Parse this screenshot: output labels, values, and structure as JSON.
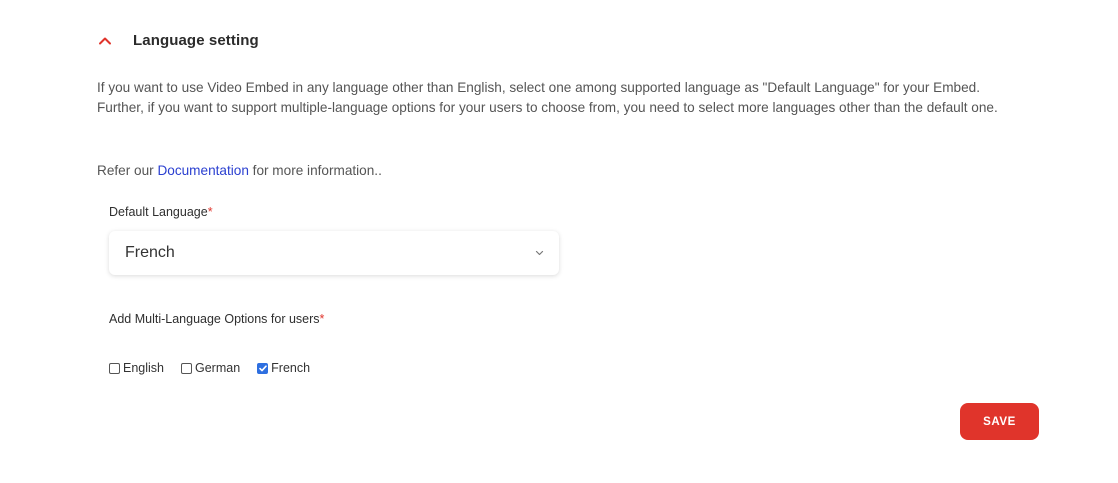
{
  "section": {
    "title": "Language setting",
    "expanded": true,
    "toggle_icon": "chevron-up-icon",
    "accent_color": "#e0342b"
  },
  "description": "If you want to use Video Embed in any language other than English, select one among supported language as \"Default Language\" for your Embed. Further, if you want to support multiple-language options for your users to choose from, you need to select more languages other than the default one.",
  "refer": {
    "prefix": "Refer our ",
    "link_text": "Documentation",
    "suffix": " for more information.."
  },
  "default_language": {
    "label": "Default Language",
    "required_mark": "*",
    "selected": "French",
    "caret_icon": "chevron-down-icon"
  },
  "multi_language": {
    "label": "Add Multi-Language Options for users",
    "required_mark": "*",
    "options": [
      {
        "label": "English",
        "checked": false
      },
      {
        "label": "German",
        "checked": false
      },
      {
        "label": "French",
        "checked": true
      }
    ]
  },
  "save_button": {
    "label": "SAVE",
    "color": "#e0342b"
  }
}
